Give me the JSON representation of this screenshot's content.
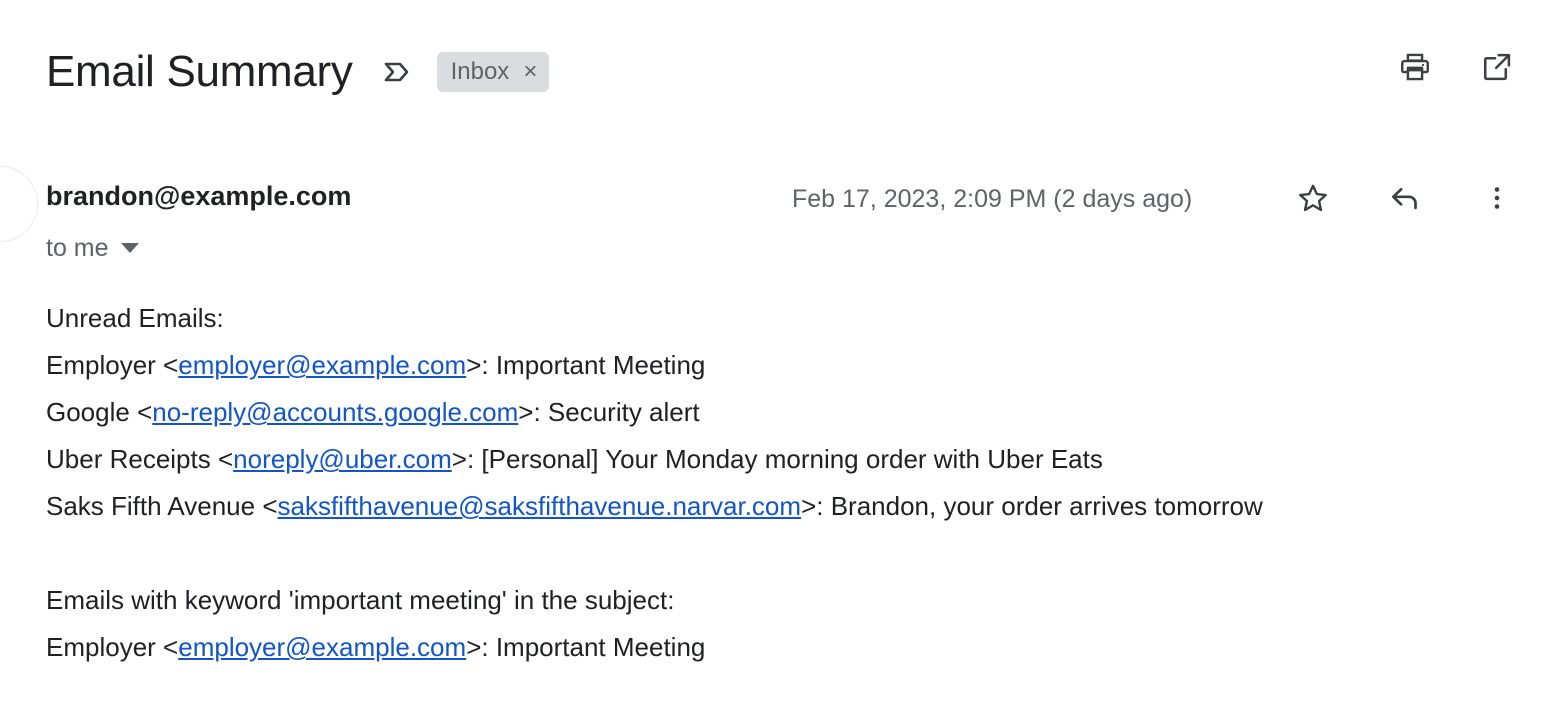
{
  "header": {
    "subject": "Email Summary",
    "label_icon": "label-arrow-icon",
    "chip": {
      "label": "Inbox",
      "close": "×"
    },
    "actions": [
      {
        "name": "print-icon",
        "title": "Print all"
      },
      {
        "name": "open-in-new-icon",
        "title": "Open in new window"
      }
    ]
  },
  "message": {
    "sender": "brandon@example.com",
    "date": "Feb 17, 2023, 2:09 PM (2 days ago)",
    "to": "to me",
    "actions": [
      {
        "name": "star-icon",
        "title": "Not starred"
      },
      {
        "name": "reply-icon",
        "title": "Reply"
      },
      {
        "name": "more-options-icon",
        "title": "More"
      }
    ]
  },
  "body": {
    "unread_heading": "Unread Emails:",
    "unread": [
      {
        "prefix": "Employer <",
        "email": "employer@example.com",
        "suffix": ">: Important Meeting"
      },
      {
        "prefix": "Google <",
        "email": "no-reply@accounts.google.com",
        "suffix": ">: Security alert"
      },
      {
        "prefix": "Uber Receipts <",
        "email": "noreply@uber.com",
        "suffix": ">: [Personal] Your Monday morning order with Uber Eats"
      },
      {
        "prefix": "Saks Fifth Avenue <",
        "email": "saksfifthavenue@saksfifthavenue.narvar.com",
        "suffix": ">: Brandon, your order arrives tomorrow"
      }
    ],
    "keyword_heading": "Emails with keyword 'important meeting' in the subject:",
    "keyword_results": [
      {
        "prefix": "Employer <",
        "email": "employer@example.com",
        "suffix": ">: Important Meeting"
      }
    ]
  },
  "colors": {
    "link": "#1155cc",
    "text": "#202124",
    "muted": "#5f6368",
    "chip_bg": "#dadce0",
    "background": "#ffffff"
  }
}
